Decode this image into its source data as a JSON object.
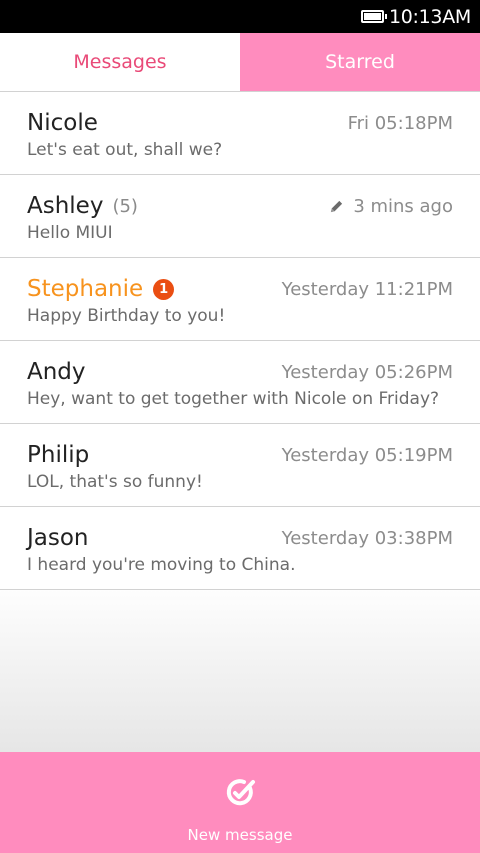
{
  "status_bar": {
    "time": "10:13AM"
  },
  "tabs": [
    {
      "label": "Messages",
      "active": true
    },
    {
      "label": "Starred",
      "active": false
    }
  ],
  "conversations": [
    {
      "name": "Nicole",
      "time": "Fri 05:18PM",
      "preview": "Let's eat out, shall we?"
    },
    {
      "name": "Ashley",
      "count": "(5)",
      "time": "3 mins ago",
      "draft": true,
      "preview": "Hello MIUI"
    },
    {
      "name": "Stephanie",
      "unread_badge": "1",
      "time": "Yesterday 11:21PM",
      "preview": "Happy Birthday to you!"
    },
    {
      "name": "Andy",
      "time": "Yesterday 05:26PM",
      "preview": "Hey, want to get together with Nicole on Friday?"
    },
    {
      "name": "Philip",
      "time": "Yesterday 05:19PM",
      "preview": "LOL, that's so funny!"
    },
    {
      "name": "Jason",
      "time": "Yesterday 03:38PM",
      "preview": "I heard you're moving to China."
    }
  ],
  "bottom_bar": {
    "label": "New message"
  },
  "colors": {
    "accent_pink": "#ff8cbe",
    "active_tab_text": "#e94a78",
    "unread_name": "#f7931e",
    "badge": "#ea4e12"
  }
}
